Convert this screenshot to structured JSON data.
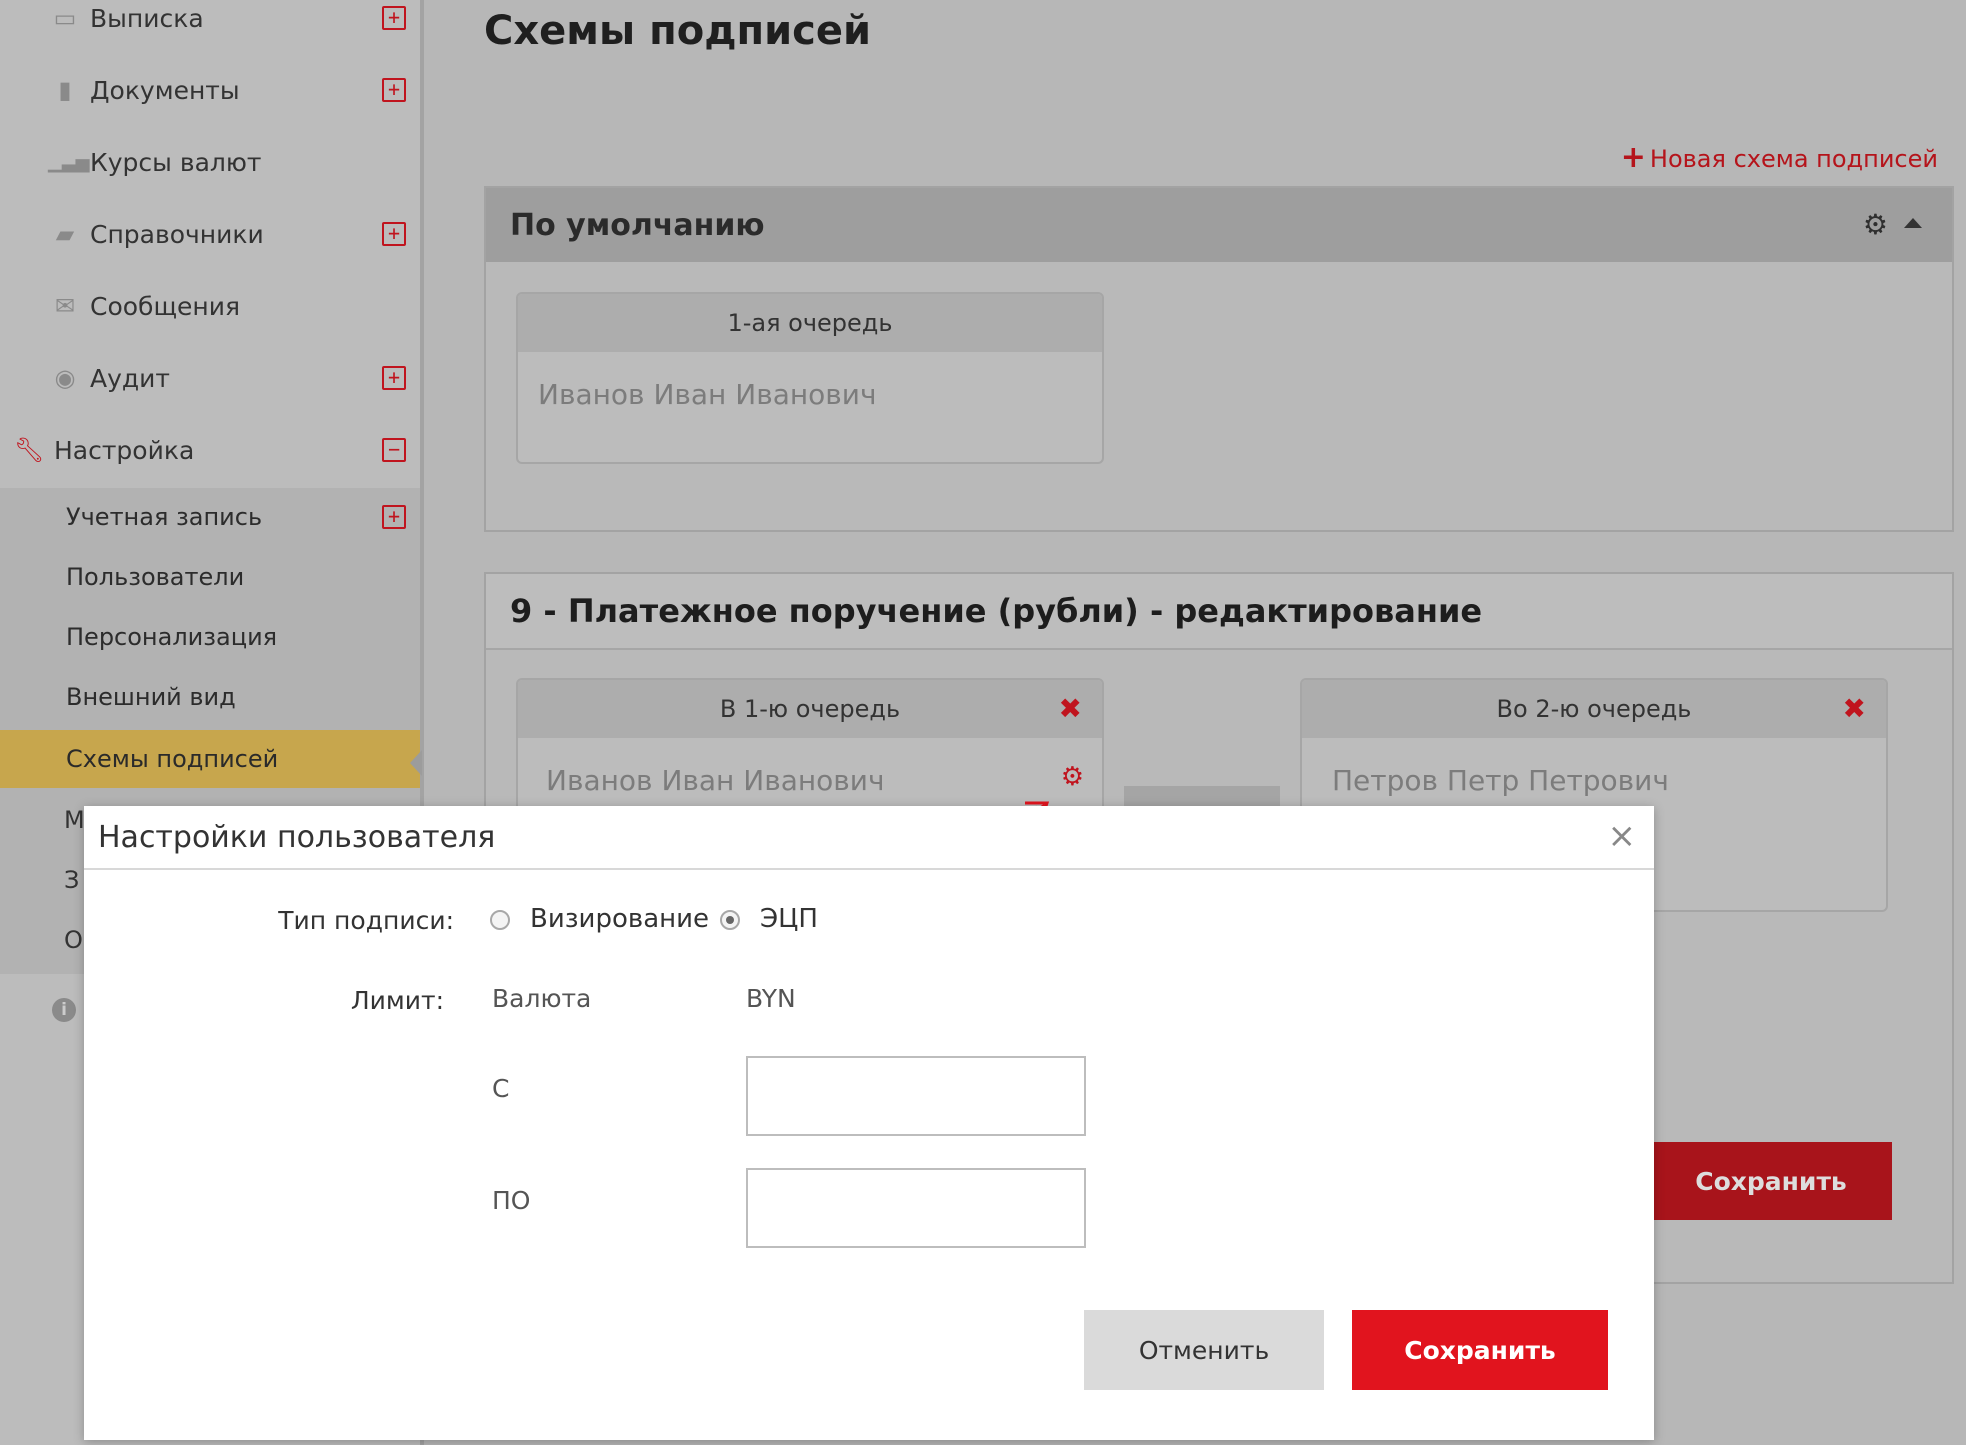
{
  "sidebar": {
    "items": [
      {
        "label": "Выписка",
        "icon": "statement-icon",
        "expandable": true
      },
      {
        "label": "Документы",
        "icon": "document-icon",
        "expandable": true
      },
      {
        "label": "Курсы валют",
        "icon": "bar-chart-icon",
        "expandable": false
      },
      {
        "label": "Справочники",
        "icon": "folder-icon",
        "expandable": true
      },
      {
        "label": "Сообщения",
        "icon": "envelope-icon",
        "expandable": false
      },
      {
        "label": "Аудит",
        "icon": "eye-icon",
        "expandable": true
      },
      {
        "label": "Настройка",
        "icon": "wrench-icon",
        "expandable": true,
        "expanded": true
      }
    ],
    "sub_items": [
      {
        "label": "Учетная запись",
        "expandable": true
      },
      {
        "label": "Пользователи"
      },
      {
        "label": "Персонализация"
      },
      {
        "label": "Внешний вид"
      },
      {
        "label": "Схемы подписей",
        "active": true
      }
    ],
    "peek_letters": [
      "М",
      "З",
      "О"
    ],
    "expand_symbol": "+",
    "collapse_symbol": "−"
  },
  "page": {
    "title": "Схемы подписей",
    "new_scheme": "Новая схема подписей"
  },
  "scheme_default": {
    "title": "По умолчанию",
    "queues": [
      {
        "title": "1-ая очередь",
        "users": [
          "Иванов Иван Иванович"
        ]
      }
    ]
  },
  "scheme_edit": {
    "title": "9 - Платежное поручение (рубли) - редактирование",
    "queues": [
      {
        "title": "В 1-ю очередь",
        "users": [
          "Иванов Иван Иванович"
        ]
      },
      {
        "title": "Во 2-ю очередь",
        "users": [
          "Петров Петр Петрович"
        ]
      }
    ],
    "save_label": "Сохранить"
  },
  "modal": {
    "title": "Настройки пользователя",
    "signature_type_label": "Тип подписи:",
    "options": [
      "Визирование",
      "ЭЦП"
    ],
    "selected_option": "ЭЦП",
    "limit_label": "Лимит:",
    "currency_label": "Валюта",
    "currency_value": "BYN",
    "from_label": "С",
    "from_value": "",
    "to_label": "ПО",
    "to_value": "",
    "cancel_label": "Отменить",
    "save_label": "Сохранить"
  },
  "colors": {
    "accent_red": "#e1141e",
    "active_nav": "#c7a64d"
  }
}
